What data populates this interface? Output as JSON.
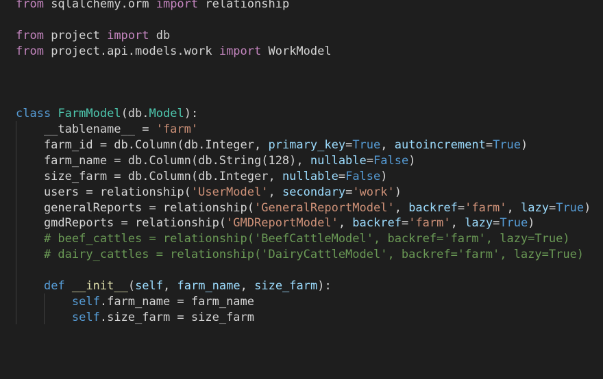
{
  "editor": {
    "language": "python",
    "colors": {
      "background": "#1e1e1e",
      "keyword": "#c586c0",
      "keyword_def": "#569cd6",
      "class_name": "#4ec9b0",
      "function_name": "#dcdcaa",
      "string": "#ce9178",
      "comment": "#6a9955",
      "parameter": "#9cdcfe",
      "plain": "#d4d4d4"
    },
    "lines": [
      [
        {
          "t": "from",
          "c": "kw"
        },
        {
          "t": " sqlalchemy.orm ",
          "c": "plain"
        },
        {
          "t": "import",
          "c": "kw"
        },
        {
          "t": " relationship",
          "c": "plain"
        }
      ],
      [],
      [
        {
          "t": "from",
          "c": "kw"
        },
        {
          "t": " project ",
          "c": "plain"
        },
        {
          "t": "import",
          "c": "kw"
        },
        {
          "t": " db",
          "c": "plain"
        }
      ],
      [
        {
          "t": "from",
          "c": "kw"
        },
        {
          "t": " project.api.models.work ",
          "c": "plain"
        },
        {
          "t": "import",
          "c": "kw"
        },
        {
          "t": " WorkModel",
          "c": "plain"
        }
      ],
      [],
      [],
      [],
      [
        {
          "t": "class",
          "c": "kw2"
        },
        {
          "t": " ",
          "c": "plain"
        },
        {
          "t": "FarmModel",
          "c": "cls"
        },
        {
          "t": "(db.",
          "c": "plain"
        },
        {
          "t": "Model",
          "c": "cls"
        },
        {
          "t": "):",
          "c": "plain"
        }
      ],
      [
        {
          "t": "    __tablename__ = ",
          "c": "plain"
        },
        {
          "t": "'farm'",
          "c": "str"
        }
      ],
      [
        {
          "t": "    farm_id = db.Column(db.Integer, ",
          "c": "plain"
        },
        {
          "t": "primary_key",
          "c": "param"
        },
        {
          "t": "=",
          "c": "plain"
        },
        {
          "t": "True",
          "c": "kw2"
        },
        {
          "t": ", ",
          "c": "plain"
        },
        {
          "t": "autoincrement",
          "c": "param"
        },
        {
          "t": "=",
          "c": "plain"
        },
        {
          "t": "True",
          "c": "kw2"
        },
        {
          "t": ")",
          "c": "plain"
        }
      ],
      [
        {
          "t": "    farm_name = db.Column(db.String(128), ",
          "c": "plain"
        },
        {
          "t": "nullable",
          "c": "param"
        },
        {
          "t": "=",
          "c": "plain"
        },
        {
          "t": "False",
          "c": "kw2"
        },
        {
          "t": ")",
          "c": "plain"
        }
      ],
      [
        {
          "t": "    size_farm = db.Column(db.Integer, ",
          "c": "plain"
        },
        {
          "t": "nullable",
          "c": "param"
        },
        {
          "t": "=",
          "c": "plain"
        },
        {
          "t": "False",
          "c": "kw2"
        },
        {
          "t": ")",
          "c": "plain"
        }
      ],
      [
        {
          "t": "    users = relationship(",
          "c": "plain"
        },
        {
          "t": "'UserModel'",
          "c": "str"
        },
        {
          "t": ", ",
          "c": "plain"
        },
        {
          "t": "secondary",
          "c": "param"
        },
        {
          "t": "=",
          "c": "plain"
        },
        {
          "t": "'work'",
          "c": "str"
        },
        {
          "t": ")",
          "c": "plain"
        }
      ],
      [
        {
          "t": "    generalReports = relationship(",
          "c": "plain"
        },
        {
          "t": "'GeneralReportModel'",
          "c": "str"
        },
        {
          "t": ", ",
          "c": "plain"
        },
        {
          "t": "backref",
          "c": "param"
        },
        {
          "t": "=",
          "c": "plain"
        },
        {
          "t": "'farm'",
          "c": "str"
        },
        {
          "t": ", ",
          "c": "plain"
        },
        {
          "t": "lazy",
          "c": "param"
        },
        {
          "t": "=",
          "c": "plain"
        },
        {
          "t": "True",
          "c": "kw2"
        },
        {
          "t": ")",
          "c": "plain"
        }
      ],
      [
        {
          "t": "    gmdReports = relationship(",
          "c": "plain"
        },
        {
          "t": "'GMDReportModel'",
          "c": "str"
        },
        {
          "t": ", ",
          "c": "plain"
        },
        {
          "t": "backref",
          "c": "param"
        },
        {
          "t": "=",
          "c": "plain"
        },
        {
          "t": "'farm'",
          "c": "str"
        },
        {
          "t": ", ",
          "c": "plain"
        },
        {
          "t": "lazy",
          "c": "param"
        },
        {
          "t": "=",
          "c": "plain"
        },
        {
          "t": "True",
          "c": "kw2"
        },
        {
          "t": ")",
          "c": "plain"
        }
      ],
      [
        {
          "t": "    ",
          "c": "plain"
        },
        {
          "t": "# beef_cattles = relationship('BeefCattleModel', backref='farm', lazy=True)",
          "c": "cm"
        }
      ],
      [
        {
          "t": "    ",
          "c": "plain"
        },
        {
          "t": "# dairy_cattles = relationship('DairyCattleModel', backref='farm', lazy=True)",
          "c": "cm"
        }
      ],
      [],
      [
        {
          "t": "    ",
          "c": "plain"
        },
        {
          "t": "def",
          "c": "kw2"
        },
        {
          "t": " ",
          "c": "plain"
        },
        {
          "t": "__init__",
          "c": "fn"
        },
        {
          "t": "(",
          "c": "plain"
        },
        {
          "t": "self",
          "c": "param"
        },
        {
          "t": ", ",
          "c": "plain"
        },
        {
          "t": "farm_name",
          "c": "param"
        },
        {
          "t": ", ",
          "c": "plain"
        },
        {
          "t": "size_farm",
          "c": "param"
        },
        {
          "t": "):",
          "c": "plain"
        }
      ],
      [
        {
          "t": "        ",
          "c": "plain"
        },
        {
          "t": "self",
          "c": "kw2"
        },
        {
          "t": ".farm_name = farm_name",
          "c": "plain"
        }
      ],
      [
        {
          "t": "        ",
          "c": "plain"
        },
        {
          "t": "self",
          "c": "kw2"
        },
        {
          "t": ".size_farm = size_farm",
          "c": "plain"
        }
      ]
    ]
  }
}
